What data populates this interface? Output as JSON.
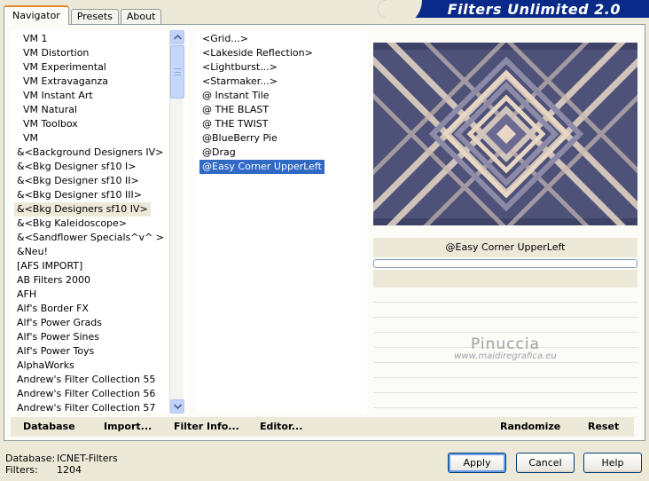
{
  "window": {
    "title": "Filters Unlimited 2.0"
  },
  "tabs": [
    {
      "label": "Navigator",
      "active": true
    },
    {
      "label": "Presets",
      "active": false
    },
    {
      "label": "About",
      "active": false
    }
  ],
  "categories": [
    "VM 1",
    "VM Distortion",
    "VM Experimental",
    "VM Extravaganza",
    "VM Instant Art",
    "VM Natural",
    "VM Toolbox",
    "VM",
    "&<Background Designers IV>",
    "&<Bkg Designer sf10 I>",
    "&<Bkg Designer sf10 II>",
    "&<Bkg Designer sf10 III>",
    "&<Bkg Designers sf10 IV>",
    "&<Bkg Kaleidoscope>",
    "&<Sandflower Specials^v^ >",
    "&Neu!",
    "[AFS IMPORT]",
    "AB Filters 2000",
    "AFH",
    "Alf's Border FX",
    "Alf's Power Grads",
    "Alf's Power Sines",
    "Alf's Power Toys",
    "AlphaWorks",
    "Andrew's Filter Collection 55",
    "Andrew's Filter Collection 56",
    "Andrew's Filter Collection 57"
  ],
  "selected_category": "&<Bkg Designers sf10 IV>",
  "filters": [
    "<Grid...>",
    "<Lakeside Reflection>",
    "<Lightburst...>",
    "<Starmaker...>",
    "@ Instant Tile",
    "@ THE BLAST",
    "@ THE TWIST",
    "@BlueBerry Pie",
    "@Drag",
    "@Easy Corner UpperLeft"
  ],
  "selected_filter": "@Easy Corner UpperLeft",
  "preview": {
    "filter_name": "@Easy Corner UpperLeft",
    "progress": 0
  },
  "watermark": {
    "name": "Pinuccia",
    "url": "www.maidiregrafica.eu"
  },
  "toolbar": {
    "database": "Database",
    "import": "Import...",
    "filter_info": "Filter Info...",
    "editor": "Editor...",
    "randomize": "Randomize",
    "reset": "Reset"
  },
  "status": {
    "database_label": "Database:",
    "database_value": "ICNET-Filters",
    "filters_label": "Filters:",
    "filters_value": "1204"
  },
  "buttons": {
    "apply": "Apply",
    "cancel": "Cancel",
    "help": "Help"
  },
  "colors": {
    "selection": "#316ac5",
    "banner": "#0a2a8a",
    "preview_dark": "#53577c",
    "preview_light": "#e9d8c6"
  }
}
